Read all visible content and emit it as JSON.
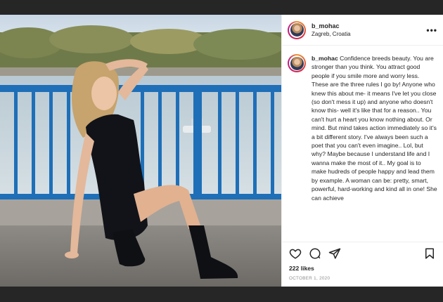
{
  "post": {
    "image_alt": "Young woman in black dress kneeling by a blue railing at a river",
    "username": "b_mohac",
    "location": "Zagreb, Croatia",
    "more_glyph": "•••",
    "caption_text": "Confidence breeds beauty. You are stronger than you think. You attract good people if you smile more and worry less. These are the three rules I go by! Anyone who knew this about me- it means I've let you close (so don't mess it up) and anyone who doesn't know this- well it's like that for a reason.. You can't hurt a heart you know nothing about. Or mind. But mind takes action immediately so it's a bit different story. I've always been such a poet that you can't even imagine.. Lol, but why? Maybe because I understand life and I wanna make the most of it.. My goal is to make hudreds of people happy and lead them by example. A woman can be: pretty, smart, powerful, hard-working and kind all in one! She can achieve",
    "likes": "222 likes",
    "date": "OCTOBER 1, 2020"
  },
  "icons": [
    "heart-icon",
    "comment-icon",
    "share-icon",
    "bookmark-icon",
    "more-options-icon"
  ],
  "colors": {
    "backdrop": "#262626",
    "panel": "#ffffff",
    "text": "#262626",
    "muted": "#8e8e8e",
    "railing": "#1e6fb8"
  }
}
